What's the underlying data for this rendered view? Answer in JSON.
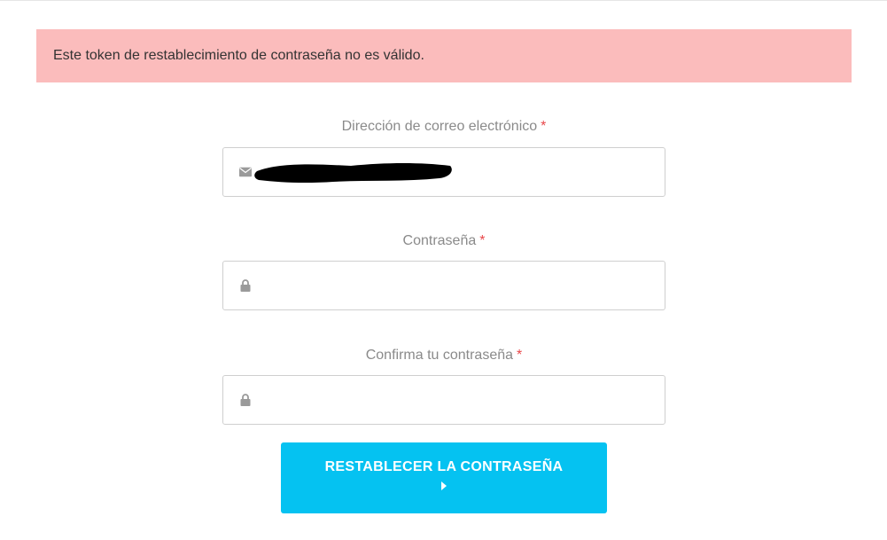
{
  "alert": {
    "message": "Este token de restablecimiento de contraseña no es válido.",
    "background": "#fbbcbc"
  },
  "form": {
    "email": {
      "label": "Dirección de correo electrónico",
      "required_mark": "*",
      "icon": "envelope-icon",
      "value": ""
    },
    "password": {
      "label": "Contraseña",
      "required_mark": "*",
      "icon": "lock-icon",
      "value": ""
    },
    "confirm_password": {
      "label": "Confirma tu contraseña",
      "required_mark": "*",
      "icon": "lock-icon",
      "value": ""
    },
    "submit": {
      "label": "RESTABLECER LA CONTRASEÑA",
      "icon": "caret-right-icon",
      "color": "#05c2f1"
    }
  }
}
